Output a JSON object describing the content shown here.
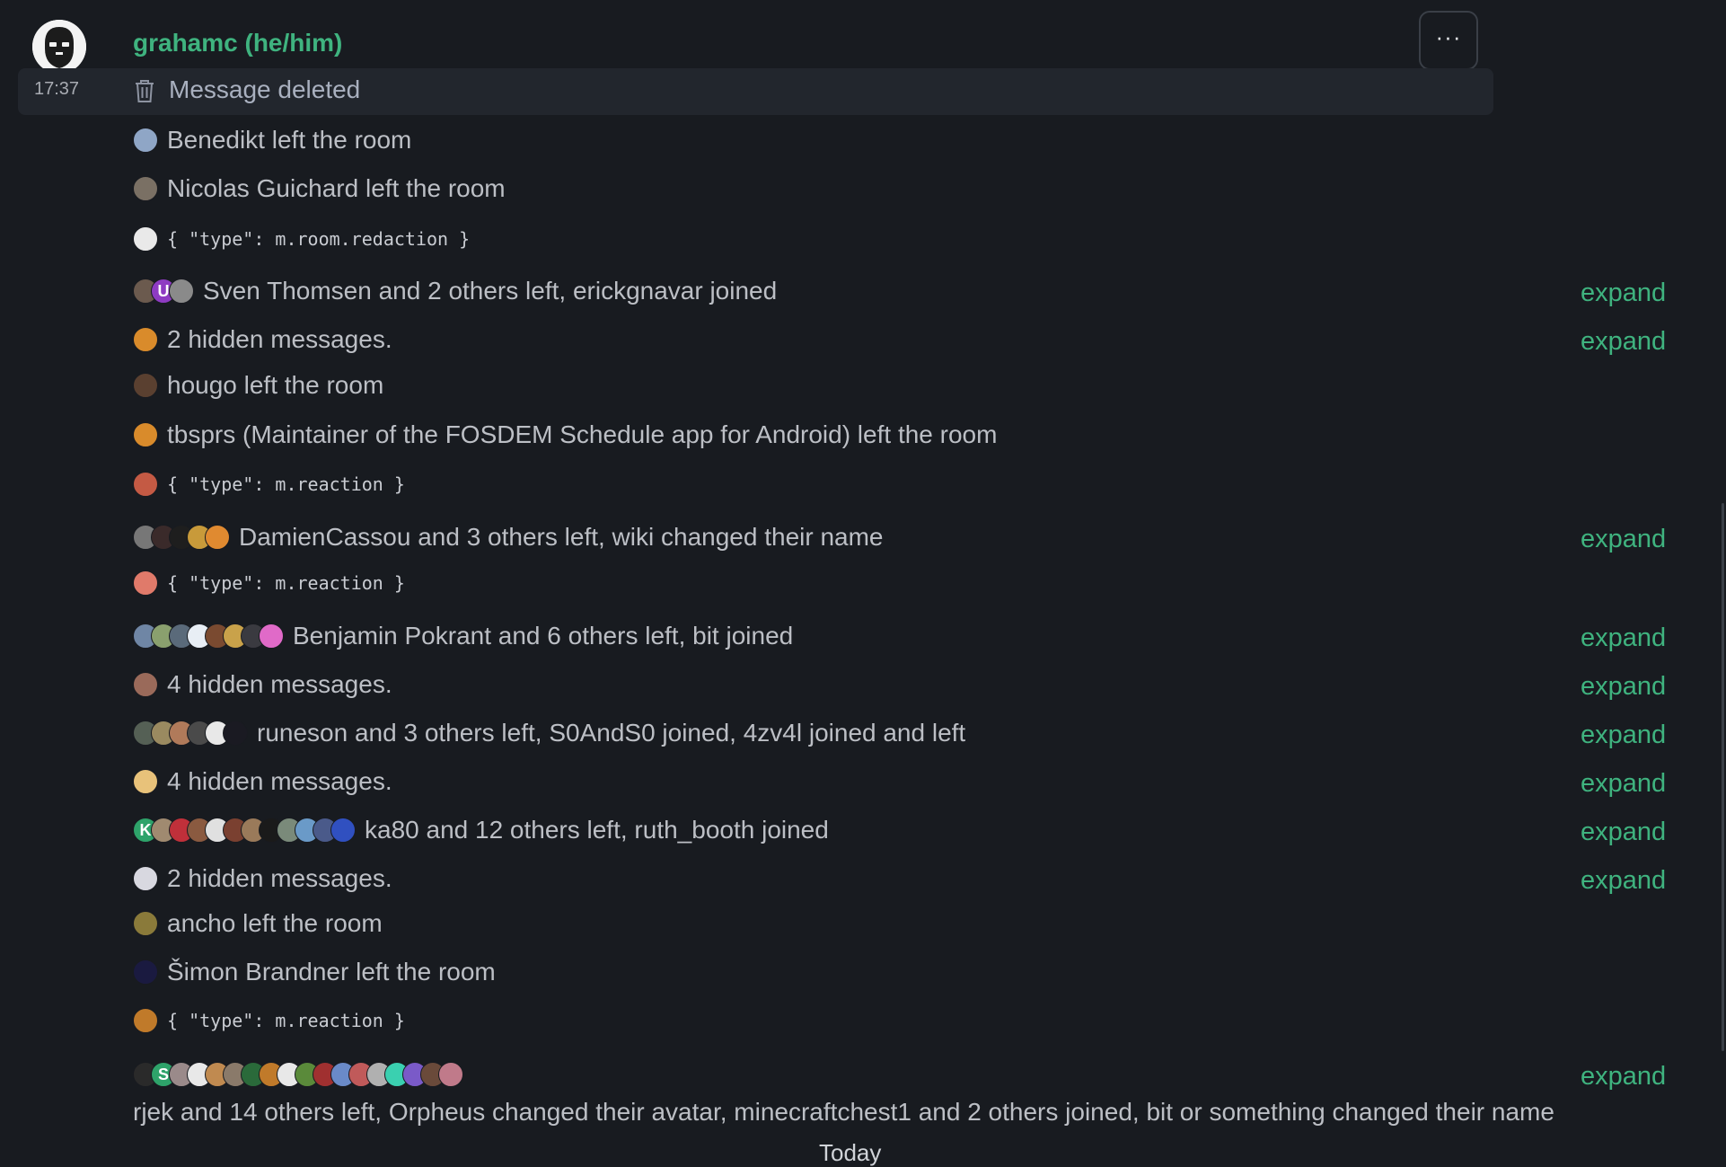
{
  "sender": {
    "name": "grahamc (he/him)",
    "time": "17:37"
  },
  "deleted": {
    "text": "Message deleted",
    "icon": "trash-icon"
  },
  "options": {
    "label": "···"
  },
  "events": [
    {
      "kind": "text",
      "text": "Benedikt left the room",
      "avatars": [
        "#8fa6c6"
      ]
    },
    {
      "kind": "text",
      "text": "Nicolas Guichard left the room",
      "avatars": [
        "#7a7064"
      ]
    },
    {
      "kind": "mono",
      "text": "{ \"type\": m.room.redaction }",
      "avatars": [
        "#e9e9e9"
      ]
    },
    {
      "kind": "text",
      "text": "Sven Thomsen and 2 others left, erickgnavar joined",
      "avatars": [
        "#6b5a4e",
        "#8e3bc2:U",
        "#8a8a8a"
      ],
      "expand": "expand"
    },
    {
      "kind": "text",
      "text": "2 hidden messages.",
      "avatars": [
        "#d98b2b"
      ],
      "expand": "expand"
    },
    {
      "kind": "text",
      "text": "hougo left the room",
      "avatars": [
        "#5a4030"
      ]
    },
    {
      "kind": "text",
      "text": "tbsprs (Maintainer of the FOSDEM Schedule app for Android) left the room",
      "avatars": [
        "#d98b2b"
      ]
    },
    {
      "kind": "mono",
      "text": "{ \"type\": m.reaction }",
      "avatars": [
        "#c45a44"
      ]
    },
    {
      "kind": "text",
      "text": "DamienCassou and 3 others left, wiki changed their name",
      "avatars": [
        "#777777",
        "#3a2a2a",
        "#1e1e1e",
        "#c89a3a",
        "#e08a30"
      ],
      "expand": "expand"
    },
    {
      "kind": "mono",
      "text": "{ \"type\": m.reaction }",
      "avatars": [
        "#e07a6a"
      ]
    },
    {
      "kind": "text",
      "text": "Benjamin Pokrant and 6 others left, bit joined",
      "avatars": [
        "#6f86a5",
        "#8aa06e",
        "#5a6a7a",
        "#e8eef5",
        "#7a4a30",
        "#c9a24a",
        "#3a3a40",
        "#e06ac8"
      ],
      "expand": "expand"
    },
    {
      "kind": "text",
      "text": "4 hidden messages.",
      "avatars": [
        "#9a6a5a"
      ],
      "expand": "expand"
    },
    {
      "kind": "text",
      "text": "runeson and 3 others left, S0AndS0 joined, 4zv4l joined and left",
      "avatars": [
        "#556055",
        "#9a8a60",
        "#b07a5a",
        "#4a4a4a",
        "#e8e8e8",
        "#1a1a22"
      ],
      "expand": "expand"
    },
    {
      "kind": "text",
      "text": "4 hidden messages.",
      "avatars": [
        "#e8c27a"
      ],
      "expand": "expand"
    },
    {
      "kind": "text",
      "text": "ka80 and 12 others left, ruth_booth joined",
      "avatars": [
        "#2ea36a:K",
        "#a08a70",
        "#c0303a",
        "#8a5a40",
        "#e0e0e0",
        "#7a4030",
        "#9a7a5a",
        "#1a1a1a",
        "#7a8a7a",
        "#6a9ac8",
        "#4a5a8a",
        "#3050c0"
      ],
      "expand": "expand"
    },
    {
      "kind": "text",
      "text": "2 hidden messages.",
      "avatars": [
        "#d8d8e0"
      ],
      "expand": "expand"
    },
    {
      "kind": "text",
      "text": "ancho left the room",
      "avatars": [
        "#8a7a3a"
      ]
    },
    {
      "kind": "text",
      "text": "Šimon Brandner left the room",
      "avatars": [
        "#1a1a40"
      ]
    },
    {
      "kind": "mono",
      "text": "{ \"type\": m.reaction }",
      "avatars": [
        "#c07a2a"
      ]
    }
  ],
  "last_event": {
    "text": "rjek and 14 others left, Orpheus changed their avatar, minecraftchest1 and 2 others joined, bit or something changed their name",
    "avatars": [
      "#2a2a2a",
      "#2ea36a:S",
      "#9a8a8a",
      "#e8e8e8",
      "#c08a50",
      "#8a7a6a",
      "#2a6a3a",
      "#c07a2a",
      "#e8e8e8",
      "#5a8a3a",
      "#a03030",
      "#6a8ac8",
      "#c05a5a",
      "#b0b0b0",
      "#3ad0b0",
      "#7a5ac8",
      "#6a4a3a",
      "#c07a8a"
    ],
    "expand": "expand"
  },
  "date_separator": "Today"
}
